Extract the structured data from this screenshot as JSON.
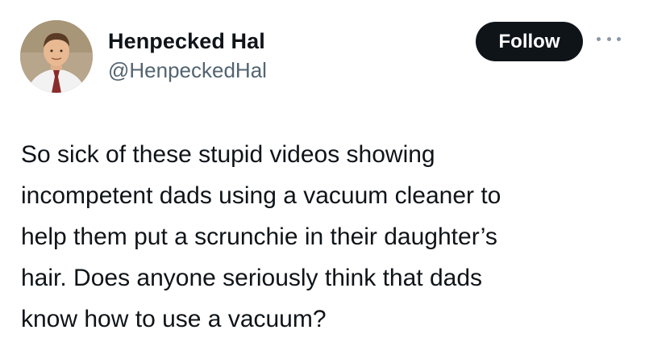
{
  "author": {
    "display_name": "Henpecked Hal",
    "handle": "@HenpeckedHal",
    "avatar_icon": "profile-photo"
  },
  "actions": {
    "follow_label": "Follow",
    "more_icon": "more-horizontal-icon"
  },
  "tweet": {
    "lines": [
      "So sick of these stupid videos showing",
      "incompetent dads using a vacuum cleaner to",
      "help them put a scrunchie in their daughter’s",
      "hair. Does anyone seriously think that dads",
      "know how to use a vacuum?"
    ]
  },
  "colors": {
    "text": "#0f1419",
    "secondary_text": "#536471",
    "follow_button_bg": "#0f1419",
    "follow_button_text": "#ffffff"
  }
}
